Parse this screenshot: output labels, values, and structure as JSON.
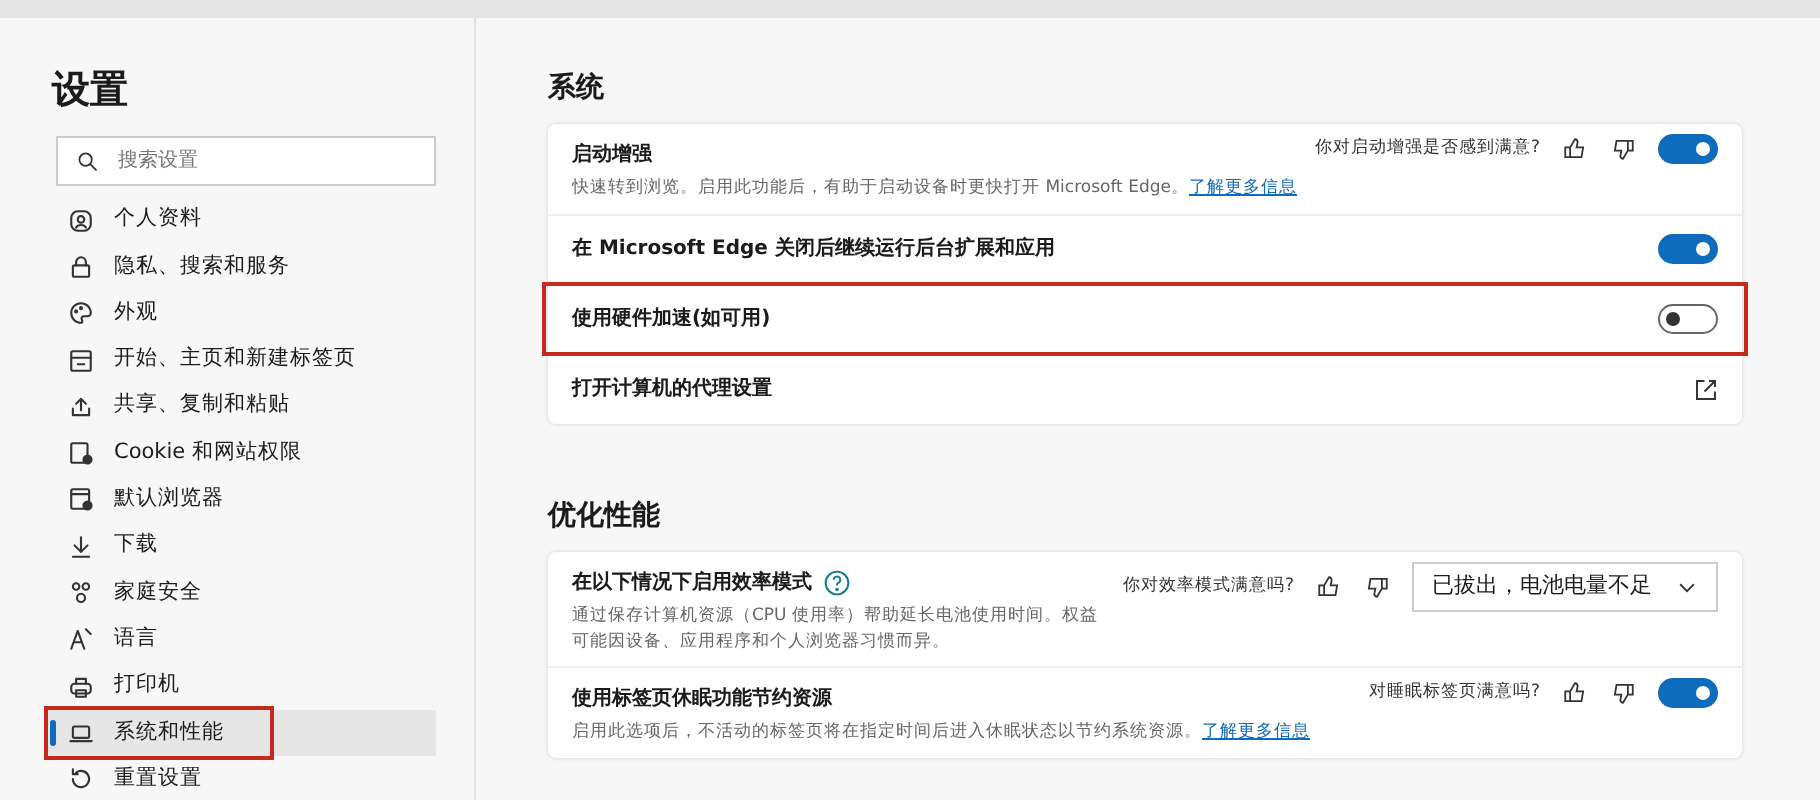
{
  "sidebar": {
    "title": "设置",
    "search": {
      "placeholder": "搜索设置"
    },
    "items": [
      {
        "label": "个人资料",
        "selected": false,
        "annotated": false
      },
      {
        "label": "隐私、搜索和服务",
        "selected": false,
        "annotated": false
      },
      {
        "label": "外观",
        "selected": false,
        "annotated": false
      },
      {
        "label": "开始、主页和新建标签页",
        "selected": false,
        "annotated": false
      },
      {
        "label": "共享、复制和粘贴",
        "selected": false,
        "annotated": false
      },
      {
        "label": "Cookie 和网站权限",
        "selected": false,
        "annotated": false
      },
      {
        "label": "默认浏览器",
        "selected": false,
        "annotated": false
      },
      {
        "label": "下载",
        "selected": false,
        "annotated": false
      },
      {
        "label": "家庭安全",
        "selected": false,
        "annotated": false
      },
      {
        "label": "语言",
        "selected": false,
        "annotated": false
      },
      {
        "label": "打印机",
        "selected": false,
        "annotated": false
      },
      {
        "label": "系统和性能",
        "selected": true,
        "annotated": true
      },
      {
        "label": "重置设置",
        "selected": false,
        "annotated": false
      }
    ]
  },
  "sections": [
    {
      "title": "系统",
      "rows": [
        {
          "kind": "toggle",
          "title": "启动增强",
          "description": "快速转到浏览。启用此功能后，有助于启动设备时更快打开 Microsoft Edge。",
          "link": "了解更多信息",
          "feedback": "你对启动增强是否感到满意?",
          "on": true,
          "annotated": false
        },
        {
          "kind": "toggle",
          "title": "在 Microsoft Edge 关闭后继续运行后台扩展和应用",
          "on": true,
          "annotated": false
        },
        {
          "kind": "toggle",
          "title": "使用硬件加速(如可用)",
          "on": false,
          "annotated": true
        },
        {
          "kind": "external",
          "title": "打开计算机的代理设置",
          "annotated": false
        }
      ]
    },
    {
      "title": "优化性能",
      "rows": [
        {
          "kind": "select",
          "title": "在以下情况下启用效率模式",
          "help": true,
          "description": "通过保存计算机资源（CPU 使用率）帮助延长电池使用时间。权益可能因设备、应用程序和个人浏览器习惯而异。",
          "feedback": "你对效率模式满意吗?",
          "value": "已拔出，电池电量不足",
          "annotated": false
        },
        {
          "kind": "toggle",
          "title": "使用标签页休眠功能节约资源",
          "description": "启用此选项后，不活动的标签页将在指定时间后进入休眠状态以节约系统资源。",
          "link": "了解更多信息",
          "feedback": "对睡眠标签页满意吗?",
          "on": true,
          "annotated": false
        }
      ]
    }
  ]
}
